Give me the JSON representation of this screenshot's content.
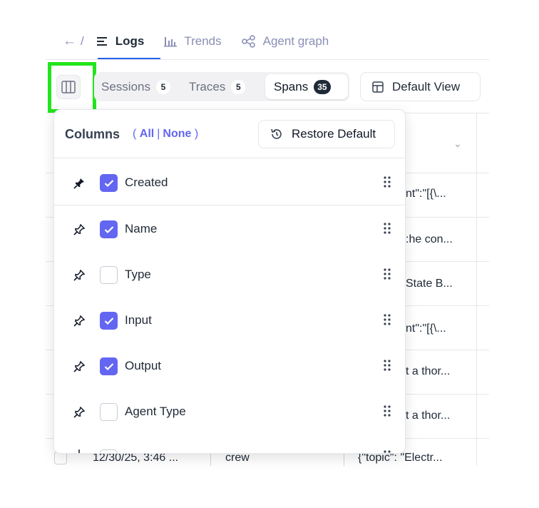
{
  "nav": {
    "back": "←",
    "slash": "/",
    "tabs": [
      {
        "label": "Logs",
        "icon": "list-lines-icon",
        "active": true
      },
      {
        "label": "Trends",
        "icon": "bar-chart-icon",
        "active": false
      },
      {
        "label": "Agent graph",
        "icon": "graph-nodes-icon",
        "active": false
      }
    ]
  },
  "toolbar": {
    "segments": [
      {
        "label": "Sessions",
        "count": "5"
      },
      {
        "label": "Traces",
        "count": "5"
      },
      {
        "label": "Spans",
        "count": "35",
        "active": true
      }
    ],
    "view_label": "Default View"
  },
  "popover": {
    "title": "Columns",
    "open_paren": "(",
    "all": "All",
    "divider": "|",
    "none": "None",
    "close_paren": ")",
    "restore_label": "Restore Default",
    "columns": [
      {
        "label": "Created",
        "checked": true,
        "pinned": true
      },
      {
        "label": "Name",
        "checked": true,
        "pinned": false
      },
      {
        "label": "Type",
        "checked": false,
        "pinned": false
      },
      {
        "label": "Input",
        "checked": true,
        "pinned": false
      },
      {
        "label": "Output",
        "checked": true,
        "pinned": false
      },
      {
        "label": "Agent Type",
        "checked": false,
        "pinned": false
      }
    ]
  },
  "table": {
    "input_cells": [
      "nt\":\"[{\\...",
      ":he con...",
      "State B...",
      "nt\":\"[{\\...",
      "t a thor...",
      "t a thor..."
    ],
    "last_row": {
      "created": "12/30/25, 3:46 ...",
      "name": "crew",
      "input": "{\"topic\": \"Electr..."
    }
  },
  "colors": {
    "accent": "#6366f1",
    "highlight": "#22e51c",
    "active_tab_underline": "#2563eb"
  }
}
